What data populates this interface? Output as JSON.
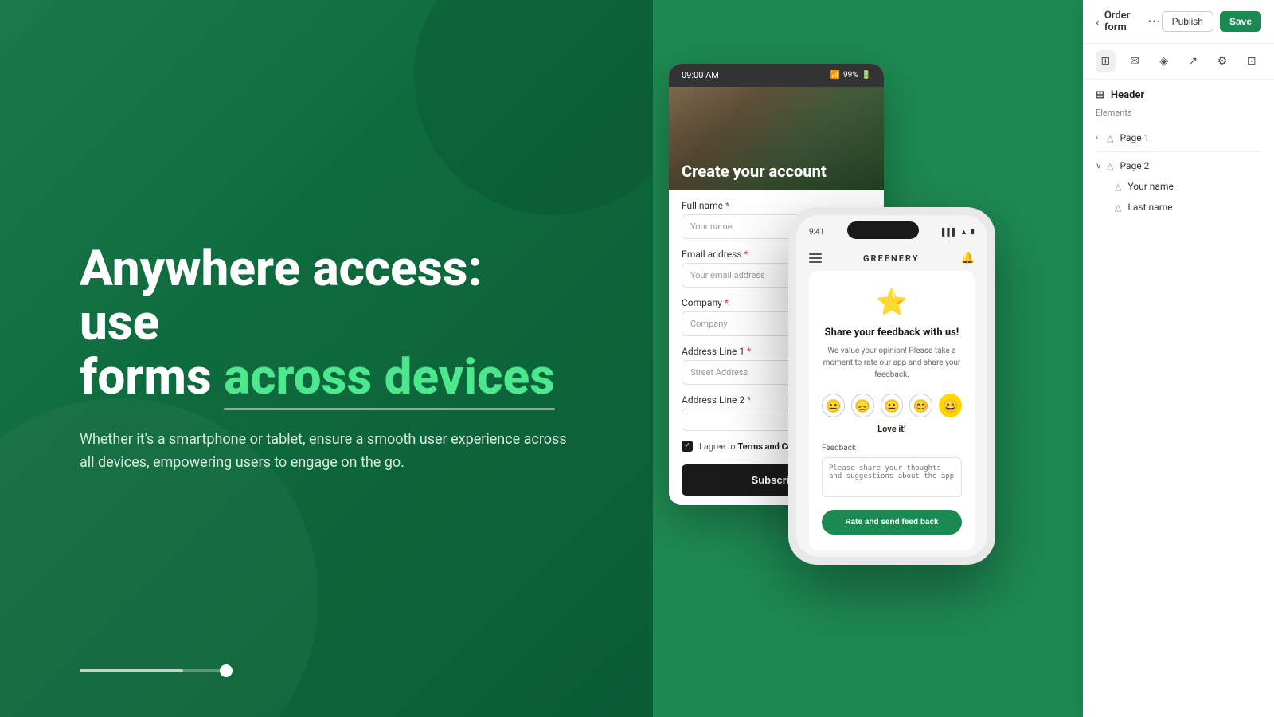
{
  "hero": {
    "title_part1": "Anywhere access: use",
    "title_part2": "forms ",
    "title_highlight": "across devices",
    "description": "Whether it's a smartphone or tablet, ensure a smooth user experience across all devices, empowering users to engage on the go."
  },
  "tablet": {
    "status_time": "09:00 AM",
    "status_battery": "99%",
    "hero_title": "Create your account",
    "fields": [
      {
        "label": "Full name",
        "placeholder": "Your name",
        "required": true
      },
      {
        "label": "Email address",
        "placeholder": "Your email address",
        "required": true
      },
      {
        "label": "Company",
        "placeholder": "Company",
        "required": true
      },
      {
        "label": "Address Line 1",
        "placeholder": "Street Address",
        "required": true
      },
      {
        "label": "Address Line 2",
        "placeholder": "",
        "required": true
      }
    ],
    "terms_text": "I agree to ",
    "terms_link": "Terms and Conditions",
    "subscribe_label": "Subscribe"
  },
  "phone": {
    "status_time": "9:41",
    "brand": "GREENERY",
    "feedback": {
      "title": "Share your feedback with us!",
      "description": "We value your opinion!\nPlease take a moment to rate our app\nand share your feedback.",
      "selected_emoji": "love",
      "selected_label": "Love it!",
      "feedback_label": "Feedback",
      "feedback_placeholder": "Please share your thoughts and suggestions about the app",
      "rate_button": "Rate and send feed back"
    }
  },
  "sidebar": {
    "back_label": "Order form",
    "publish_label": "Publish",
    "save_label": "Save",
    "header_label": "Header",
    "elements_label": "Elements",
    "pages": [
      {
        "label": "Page 1",
        "expanded": false
      },
      {
        "label": "Page 2",
        "expanded": true,
        "children": [
          {
            "label": "Your name"
          },
          {
            "label": "Last name"
          }
        ]
      }
    ]
  }
}
